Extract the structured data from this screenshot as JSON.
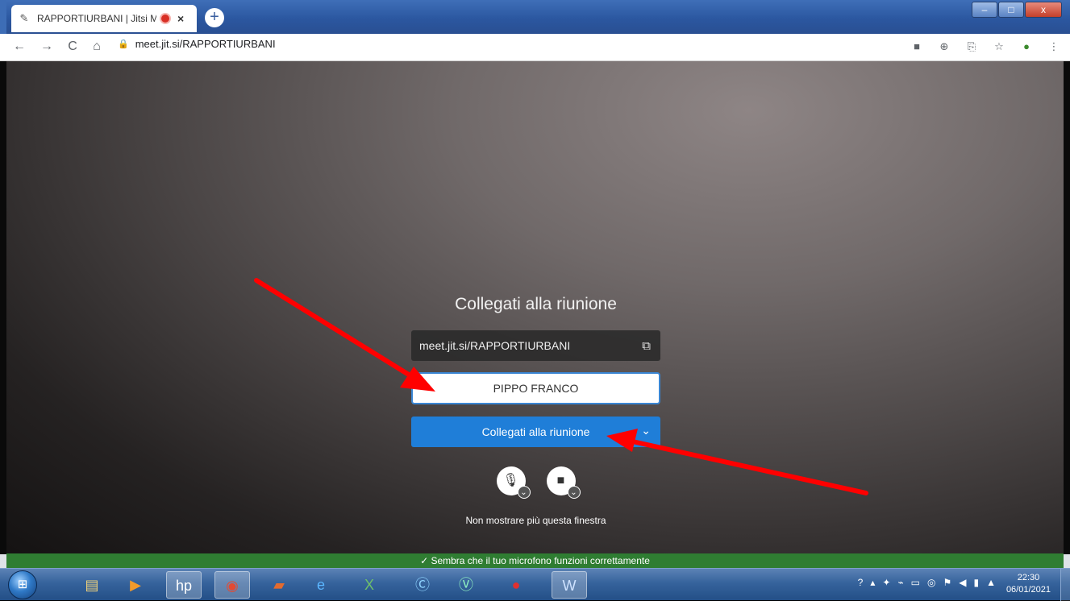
{
  "browser": {
    "tab": {
      "title": "RAPPORTIURBANI | Jitsi Mee",
      "close_label": "×",
      "favicon_icon": "feather-icon"
    },
    "new_tab_label": "+",
    "window_controls": {
      "minimize": "–",
      "maximize": "□",
      "close": "x"
    },
    "address_bar": {
      "url": "meet.jit.si/RAPPORTIURBANI",
      "lock_icon": "lock-icon"
    },
    "nav": {
      "back": "←",
      "forward": "→",
      "reload": "C",
      "home": "⌂"
    },
    "toolbar_icons": [
      "camera-icon",
      "zoom-icon",
      "translate-icon",
      "star-icon",
      "extension-leaf-icon",
      "menu-dots-icon"
    ]
  },
  "prejoin": {
    "heading": "Collegati alla riunione",
    "meeting_url": "meet.jit.si/RAPPORTIURBANI",
    "name_value": "PIPPO FRANCO",
    "join_button": "Collegati alla riunione",
    "dont_show": "Non mostrare più questa finestra"
  },
  "notice": {
    "text": "✓  Sembra che il tuo microfono funzioni correttamente",
    "color": "#2f7d32"
  },
  "taskbar": {
    "clock_time": "22:30",
    "clock_date": "06/01/2021",
    "apps": [
      "explorer-icon",
      "media-player-icon",
      "hp-icon",
      "chrome-icon",
      "app-icon",
      "internet-explorer-icon",
      "excel-icon",
      "c-app-icon",
      "v-app-icon",
      "antivirus-icon",
      "word-icon"
    ]
  },
  "colors": {
    "accent": "#1f7ed8",
    "annotation_arrow": "#ff0000"
  }
}
